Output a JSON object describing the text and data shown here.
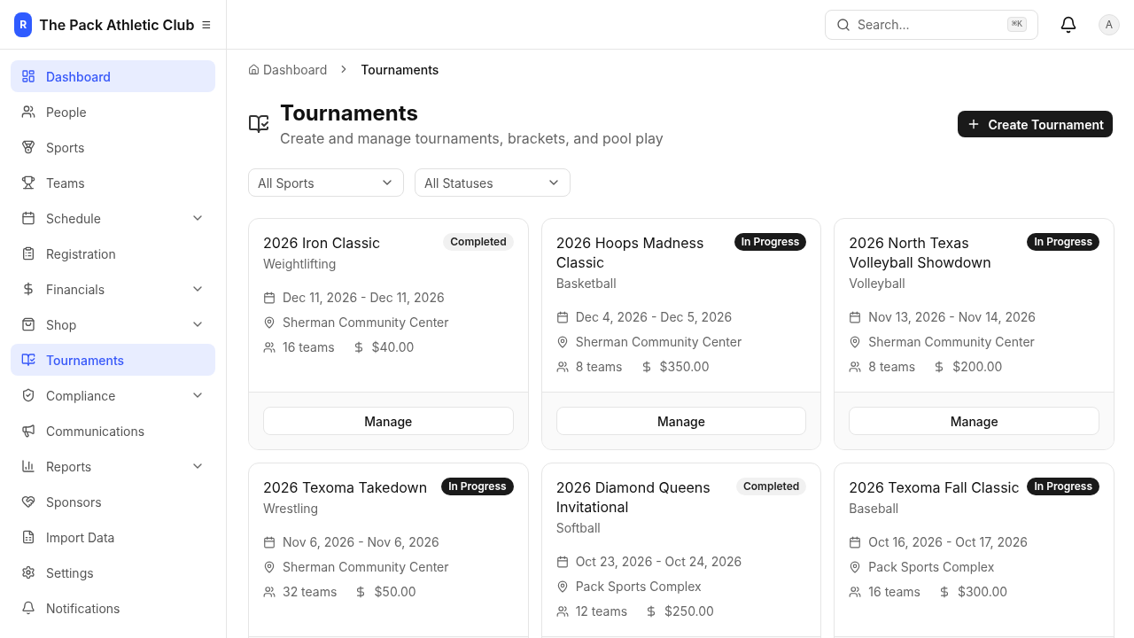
{
  "brand": {
    "logo_letter": "R",
    "name": "The Pack Athletic Club"
  },
  "sidebar": {
    "items": [
      {
        "label": "Dashboard",
        "selected": true,
        "kind": "link"
      },
      {
        "label": "People",
        "selected": false,
        "kind": "link"
      },
      {
        "label": "Sports",
        "selected": false,
        "kind": "link"
      },
      {
        "label": "Teams",
        "selected": false,
        "kind": "link"
      },
      {
        "label": "Schedule",
        "selected": false,
        "kind": "group"
      },
      {
        "label": "Registration",
        "selected": false,
        "kind": "link"
      },
      {
        "label": "Financials",
        "selected": false,
        "kind": "group"
      },
      {
        "label": "Shop",
        "selected": false,
        "kind": "group"
      },
      {
        "label": "Tournaments",
        "selected": true,
        "kind": "link"
      },
      {
        "label": "Compliance",
        "selected": false,
        "kind": "group"
      },
      {
        "label": "Communications",
        "selected": false,
        "kind": "link"
      },
      {
        "label": "Reports",
        "selected": false,
        "kind": "group"
      },
      {
        "label": "Sponsors",
        "selected": false,
        "kind": "link"
      },
      {
        "label": "Import Data",
        "selected": false,
        "kind": "link"
      },
      {
        "label": "Settings",
        "selected": false,
        "kind": "link"
      },
      {
        "label": "Notifications",
        "selected": false,
        "kind": "link"
      }
    ]
  },
  "header": {
    "search": {
      "placeholder": "Search...",
      "shortcut": "⌘K"
    },
    "avatar": "A"
  },
  "breadcrumb": [
    "Dashboard",
    "Tournaments"
  ],
  "page": {
    "title": "Tournaments",
    "subtitle": "Create and manage tournaments, brackets, and pool play",
    "action": "Create Tournament"
  },
  "filters": [
    "All Sports",
    "All Statuses"
  ],
  "tournaments": [
    {
      "name": "2026 Iron Classic",
      "status": {
        "label": "Completed",
        "kind": "completed"
      },
      "sport": "Weightlifting",
      "dates": "Dec 11, 2026 - Dec 11, 2026",
      "venue": "Sherman Community Center",
      "teams": "16 teams",
      "fee": "$40.00",
      "button": "Manage"
    },
    {
      "name": "2026 Hoops Madness Classic",
      "status": {
        "label": "In Progress",
        "kind": "in_progress"
      },
      "sport": "Basketball",
      "dates": "Dec 4, 2026 - Dec 5, 2026",
      "venue": "Sherman Community Center",
      "teams": "8 teams",
      "fee": "$350.00",
      "button": "Manage"
    },
    {
      "name": "2026 North Texas Volleyball Showdown",
      "status": {
        "label": "In Progress",
        "kind": "in_progress"
      },
      "sport": "Volleyball",
      "dates": "Nov 13, 2026 - Nov 14, 2026",
      "venue": "Sherman Community Center",
      "teams": "8 teams",
      "fee": "$200.00",
      "button": "Manage"
    },
    {
      "name": "2026 Texoma Takedown",
      "status": {
        "label": "In Progress",
        "kind": "in_progress"
      },
      "sport": "Wrestling",
      "dates": "Nov 6, 2026 - Nov 6, 2026",
      "venue": "Sherman Community Center",
      "teams": "32 teams",
      "fee": "$50.00"
    },
    {
      "name": "2026 Diamond Queens Invitational",
      "status": {
        "label": "Completed",
        "kind": "completed"
      },
      "sport": "Softball",
      "dates": "Oct 23, 2026 - Oct 24, 2026",
      "venue": "Pack Sports Complex",
      "teams": "12 teams",
      "fee": "$250.00"
    },
    {
      "name": "2026 Texoma Fall Classic",
      "status": {
        "label": "In Progress",
        "kind": "in_progress"
      },
      "sport": "Baseball",
      "dates": "Oct 16, 2026 - Oct 17, 2026",
      "venue": "Pack Sports Complex",
      "teams": "16 teams",
      "fee": "$300.00"
    }
  ]
}
